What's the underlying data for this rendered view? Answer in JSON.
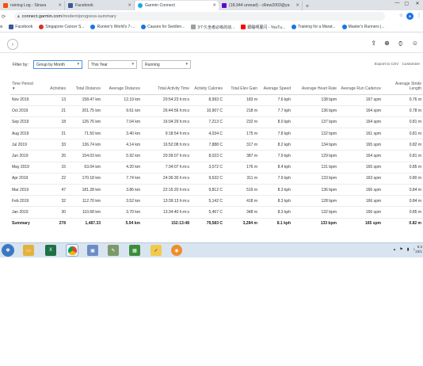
{
  "tabs": [
    {
      "label": "raining Log - Strava",
      "color": "#fc4c02",
      "active": false
    },
    {
      "label": "Facebook",
      "color": "#3b5998",
      "active": false
    },
    {
      "label": "Garmin Connect",
      "color": "#11a9ed",
      "active": true
    },
    {
      "label": "(18,944 unread) - clliew2003@ya",
      "color": "#6001d2",
      "active": false
    }
  ],
  "address": {
    "host": "connect.garmin.com",
    "path": "/modern/progress-summary"
  },
  "bookmarks": [
    {
      "label": "ps",
      "color": "#4285f4"
    },
    {
      "label": "Facebook",
      "color": "#3b5998"
    },
    {
      "label": "Singapore Cancer S...",
      "color": "#d93025"
    },
    {
      "label": "Runner's World's 7-...",
      "color": "#1a73e8"
    },
    {
      "label": "Causes for Swollen...",
      "color": "#1a73e8"
    },
    {
      "label": "3个久坐者必练的动...",
      "color": "#9e9e9e"
    },
    {
      "label": "跟睡啊厦闪 - YouTu...",
      "color": "#ff0000"
    },
    {
      "label": "Training for a Marat...",
      "color": "#1a73e8"
    },
    {
      "label": "Master's Runners |...",
      "color": "#1a73e8"
    }
  ],
  "filters": {
    "label": "Filter by:",
    "group": "Group by Month",
    "period": "This Year",
    "activity": "Running",
    "export": "Export to CSV",
    "customize": "Customize"
  },
  "columns": [
    "Time Period",
    "Activities",
    "Total Distance",
    "Average Distance",
    "Total Activity Time",
    "Activity Calories",
    "Total Elev Gain",
    "Average Speed",
    "Average Heart Rate",
    "Average Run Cadence",
    "Average Stride Length"
  ],
  "rows": [
    [
      "Nov 2019",
      "13",
      "158.47 km",
      "12.19 km",
      "20:54:23 h:m:s",
      "8,993 C",
      "183 m",
      "7.6 kph",
      "138 bpm",
      "167 spm",
      "0.76 m"
    ],
    [
      "Oct 2019",
      "21",
      "201.75 km",
      "9.61 km",
      "26:44:56 h:m:s",
      "10,907 C",
      "218 m",
      "7.7 kph",
      "136 bpm",
      "164 spm",
      "0.78 m"
    ],
    [
      "Sep 2019",
      "18",
      "126.76 km",
      "7.04 km",
      "16:04:29 h:m:s",
      "7,213 C",
      "232 m",
      "8.0 kph",
      "137 bpm",
      "164 spm",
      "0.81 m"
    ],
    [
      "Aug 2019",
      "21",
      "71.50 km",
      "3.40 km",
      "9:18:54 h:m:s",
      "4,034 C",
      "175 m",
      "7.8 kph",
      "132 bpm",
      "161 spm",
      "0.81 m"
    ],
    [
      "Jul 2019",
      "33",
      "136.74 km",
      "4.14 km",
      "16:52:08 h:m:s",
      "7,888 C",
      "317 m",
      "8.2 kph",
      "134 bpm",
      "165 spm",
      "0.82 m"
    ],
    [
      "Jun 2019",
      "26",
      "154.03 km",
      "5.92 km",
      "20:39:07 h:m:s",
      "8,023 C",
      "387 m",
      "7.9 kph",
      "129 bpm",
      "164 spm",
      "0.81 m"
    ],
    [
      "May 2019",
      "15",
      "63.04 km",
      "4.20 km",
      "7:34:07 h:m:s",
      "3,072 C",
      "176 m",
      "8.4 kph",
      "131 bpm",
      "165 spm",
      "0.85 m"
    ],
    [
      "Apr 2019",
      "22",
      "170.18 km",
      "7.74 km",
      "24:36:30 h:m:s",
      "9,632 C",
      "311 m",
      "7.9 kph",
      "133 bpm",
      "163 spm",
      "0.80 m"
    ],
    [
      "Mar 2019",
      "47",
      "181.28 km",
      "3.86 km",
      "22:15:20 h:m:s",
      "9,812 C",
      "519 m",
      "8.3 kph",
      "136 bpm",
      "166 spm",
      "0.84 m"
    ],
    [
      "Feb 2019",
      "32",
      "112.70 km",
      "3.52 km",
      "13:39:13 h:m:s",
      "5,142 C",
      "418 m",
      "8.3 kph",
      "128 bpm",
      "166 spm",
      "0.84 m"
    ],
    [
      "Jan 2019",
      "30",
      "110.68 km",
      "3.70 km",
      "13:34:40 h:m:s",
      "5,467 C",
      "348 m",
      "8.3 kph",
      "132 bpm",
      "166 spm",
      "0.85 m"
    ]
  ],
  "summary": [
    "Summary",
    "278",
    "1,487.33",
    "5.94 km",
    "152:13:48",
    "79,583 C",
    "3,284 m",
    "8.1 kph",
    "133 bpm",
    "165 spm",
    "0.82 m"
  ],
  "taskbar": {
    "clock_time": "6:3",
    "clock_date": "23/1"
  }
}
